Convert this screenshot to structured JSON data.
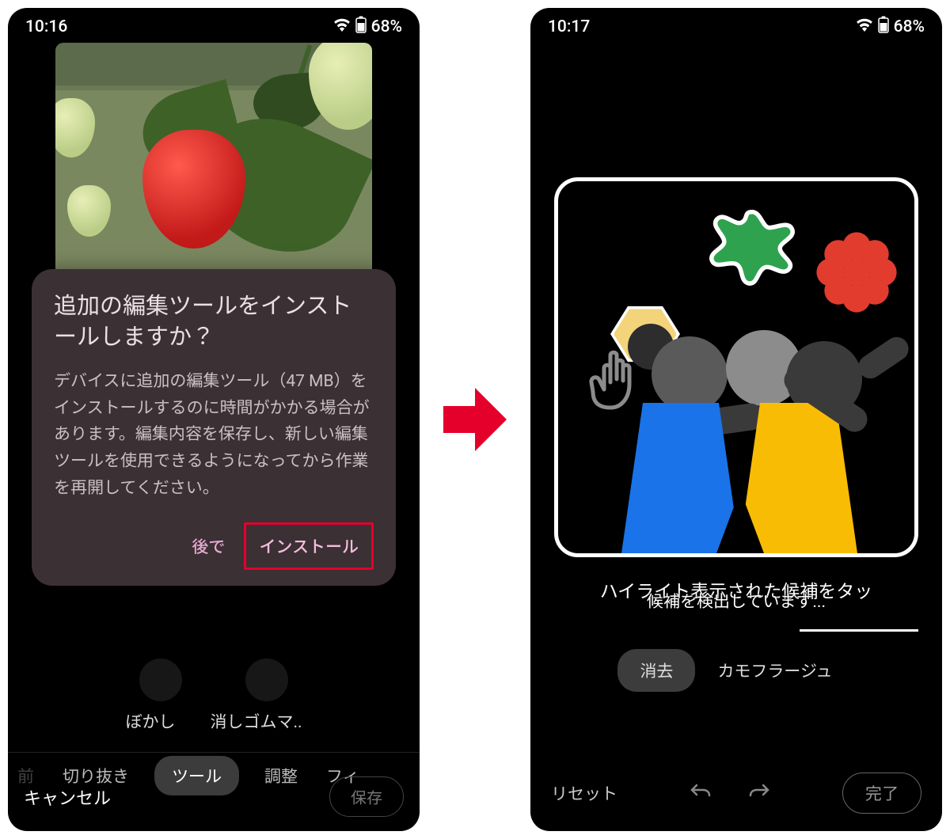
{
  "left": {
    "status": {
      "time": "10:16",
      "battery": "68%"
    },
    "dialog": {
      "title": "追加の編集ツールをインストールしますか？",
      "body": "デバイスに追加の編集ツール（47 MB）をインストールするのに時間がかかる場合があります。編集内容を保存し、新しい編集ツールを使用できるようになってから作業を再開してください。",
      "later": "後で",
      "install": "インストール"
    },
    "tool_labels": {
      "blur": "ぼかし",
      "eraser": "消しゴムマ.."
    },
    "tabs": {
      "partial_left": "前",
      "crop": "切り抜き",
      "tools": "ツール",
      "adjust": "調整",
      "filter_partial": "フィ"
    },
    "bottom": {
      "cancel": "キャンセル",
      "save": "保存"
    }
  },
  "right": {
    "status": {
      "time": "10:17",
      "battery": "68%"
    },
    "caption": {
      "line": "ハイライト表示された候補をタッ",
      "sub": "候補を検出しています..."
    },
    "modes": {
      "erase": "消去",
      "camouflage": "カモフラージュ"
    },
    "bottom": {
      "reset": "リセット",
      "done": "完了"
    }
  }
}
